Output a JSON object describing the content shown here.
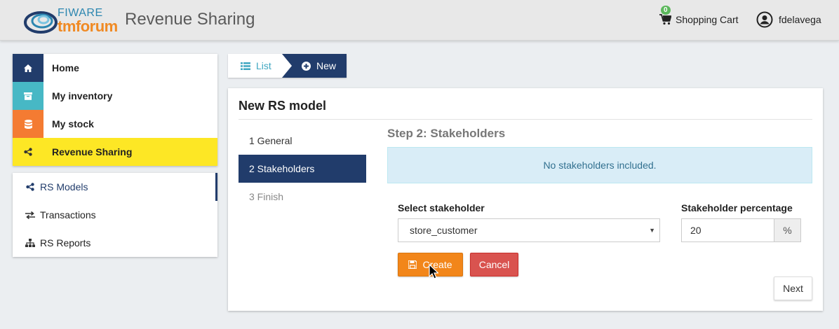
{
  "header": {
    "logo_top": "FIWARE",
    "logo_bottom": "tmforum",
    "app_title": "Revenue Sharing",
    "cart_count": "0",
    "cart_label": "Shopping Cart",
    "user_name": "fdelavega",
    "icons": {
      "cart": "shopping-cart-icon",
      "user": "user-circle-icon"
    }
  },
  "sidebar": {
    "items": [
      {
        "label": "Home",
        "icon": "home-icon",
        "color": "#213c6b"
      },
      {
        "label": "My inventory",
        "icon": "archive-icon",
        "color": "#47b8c5"
      },
      {
        "label": "My stock",
        "icon": "database-icon",
        "color": "#f47b32"
      },
      {
        "label": "Revenue Sharing",
        "icon": "share-icon",
        "color": "#fde725"
      }
    ],
    "submenu": [
      {
        "label": "RS Models",
        "icon": "share-icon",
        "active": true
      },
      {
        "label": "Transactions",
        "icon": "exchange-icon",
        "active": false
      },
      {
        "label": "RS Reports",
        "icon": "sitemap-icon",
        "active": false
      }
    ]
  },
  "breadcrumb": {
    "list_label": "List",
    "new_label": "New"
  },
  "panel": {
    "title": "New RS model",
    "steps": [
      {
        "label": "1 General",
        "state": "normal"
      },
      {
        "label": "2 Stakeholders",
        "state": "active"
      },
      {
        "label": "3 Finish",
        "state": "disabled"
      }
    ],
    "step_title": "Step 2: Stakeholders",
    "alert_text": "No stakeholders included.",
    "form": {
      "stakeholder_label": "Select stakeholder",
      "stakeholder_value": "store_customer",
      "percentage_label": "Stakeholder percentage",
      "percentage_value": "20",
      "percentage_unit": "%"
    },
    "buttons": {
      "create": "Create",
      "cancel": "Cancel",
      "next": "Next"
    }
  },
  "colors": {
    "primary": "#213c6b",
    "accent_orange": "#f2861a",
    "danger": "#d9534f",
    "info_bg": "#d9edf7",
    "highlight_yellow": "#fde725"
  }
}
